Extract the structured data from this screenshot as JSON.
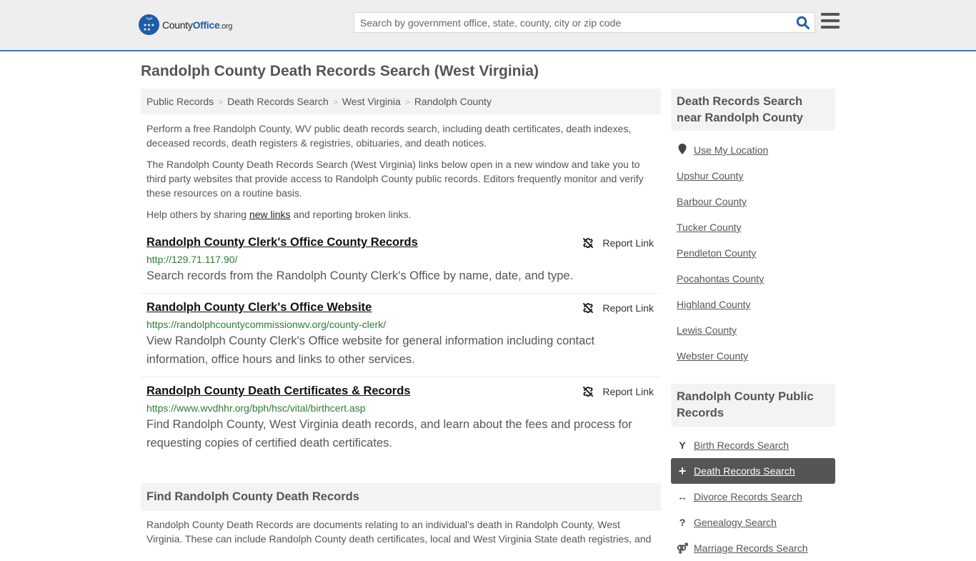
{
  "header": {
    "logo": {
      "brand_part1": "County",
      "brand_part2": "Office",
      "brand_suffix": ".org"
    },
    "search": {
      "placeholder": "Search by government office, state, county, city or zip code",
      "value": ""
    },
    "icons": {
      "search": "search-icon",
      "menu": "hamburger-menu-icon"
    }
  },
  "page": {
    "title": "Randolph County Death Records Search (West Virginia)",
    "breadcrumb": [
      "Public Records",
      "Death Records Search",
      "West Virginia",
      "Randolph County"
    ],
    "breadcrumb_separator": ">",
    "intro_1": "Perform a free Randolph County, WV public death records search, including death certificates, death indexes, deceased records, death registers & registries, obituaries, and death notices.",
    "intro_2": "The Randolph County Death Records Search (West Virginia) links below open in a new window and take you to third party websites that provide access to Randolph County public records. Editors frequently monitor and verify these resources on a routine basis.",
    "help_prefix": "Help others by sharing ",
    "help_link": "new links",
    "help_suffix": " and reporting broken links."
  },
  "links": [
    {
      "title": "Randolph County Clerk's Office County Records",
      "url": "http://129.71.117.90/",
      "description": "Search records from the Randolph County Clerk's Office by name, date, and type.",
      "report_label": "Report Link"
    },
    {
      "title": "Randolph County Clerk's Office Website",
      "url": "https://randolphcountycommissionwv.org/county-clerk/",
      "description": "View Randolph County Clerk's Office website for general information including contact information, office hours and links to other services.",
      "report_label": "Report Link"
    },
    {
      "title": "Randolph County Death Certificates & Records",
      "url": "https://www.wvdhhr.org/bph/hsc/vital/birthcert.asp",
      "description": "Find Randolph County, West Virginia death records, and learn about the fees and process for requesting copies of certified death certificates.",
      "report_label": "Report Link"
    }
  ],
  "find_section": {
    "heading": "Find Randolph County Death Records",
    "body": "Randolph County Death Records are documents relating to an individual's death in Randolph County, West Virginia. These can include Randolph County death certificates, local and West Virginia State death registries, and"
  },
  "sidebar": {
    "nearby": {
      "heading": "Death Records Search near Randolph County",
      "use_location": "Use My Location",
      "counties": [
        "Upshur County",
        "Barbour County",
        "Tucker County",
        "Pendleton County",
        "Pocahontas County",
        "Highland County",
        "Lewis County",
        "Webster County"
      ]
    },
    "public_records": {
      "heading": "Randolph County Public Records",
      "items": [
        {
          "label": "Birth Records Search",
          "icon": "child-icon",
          "glyph": "Y",
          "active": false
        },
        {
          "label": "Death Records Search",
          "icon": "plus-icon",
          "glyph": "+",
          "active": true
        },
        {
          "label": "Divorce Records Search",
          "icon": "arrows-horizontal-icon",
          "glyph": "↔",
          "active": false
        },
        {
          "label": "Genealogy Search",
          "icon": "question-icon",
          "glyph": "?",
          "active": false
        },
        {
          "label": "Marriage Records Search",
          "icon": "marriage-icon",
          "glyph": "⚤",
          "active": false
        }
      ]
    }
  },
  "colors": {
    "brand_blue": "#1e5ba8",
    "header_border": "#3b7bb6",
    "url_green": "#2e7d32",
    "active_item_bg": "#555555"
  }
}
